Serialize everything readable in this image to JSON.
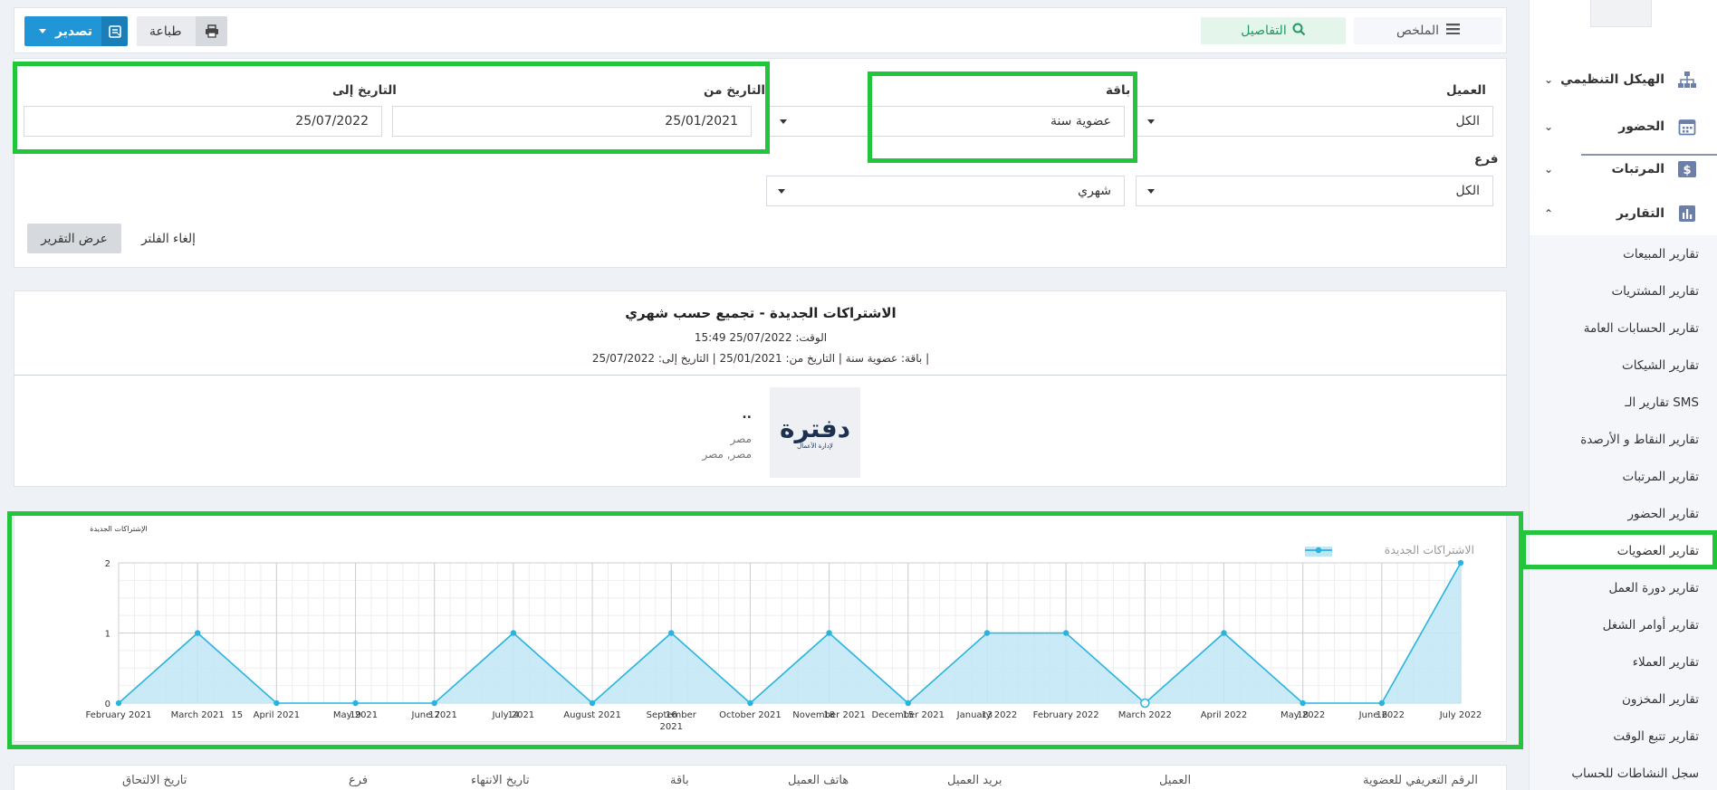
{
  "sidebar": {
    "main_items": [
      {
        "label": "الهيكل التنظيمي",
        "icon": "org-chart-icon",
        "chevron": "⌄"
      },
      {
        "label": "الحضور",
        "icon": "calendar-icon",
        "chevron": "⌄"
      },
      {
        "label": "المرتبات",
        "icon": "dollar-icon",
        "chevron": "⌄"
      },
      {
        "label": "التقارير",
        "icon": "bar-chart-icon",
        "chevron": "⌃"
      }
    ],
    "sub_items": [
      "تقارير المبيعات",
      "تقارير المشتريات",
      "تقارير الحسابات العامة",
      "تقارير الشيكات",
      "تقارير الـ SMS",
      "تقارير النقاط و الأرصدة",
      "تقارير المرتبات",
      "تقارير الحضور",
      "تقارير العضويات",
      "تقارير دورة العمل",
      "تقارير أوامر الشغل",
      "تقارير العملاء",
      "تقارير المخزون",
      "تقارير تتبع الوقت",
      "سجل النشاطات للحساب"
    ],
    "active_sub_index": 8
  },
  "toolbar": {
    "export_label": "تصدير",
    "print_label": "طباعة",
    "details_label": "التفاصيل",
    "summary_label": "الملخص"
  },
  "filters": {
    "client_label": "العميل",
    "client_value": "الكل",
    "package_label": "باقة",
    "package_value": "عضوية سنة",
    "date_from_label": "التاريخ من",
    "date_from_value": "25/01/2021",
    "date_to_label": "التاريخ إلى",
    "date_to_value": "25/07/2022",
    "branch_label": "فرع",
    "branch_value": "الكل",
    "group_value": "شهري",
    "show_report_label": "عرض التقرير",
    "clear_filter_label": "إلغاء الفلتر"
  },
  "report": {
    "title": "الاشتراكات الجديدة - تجميع حسب شهري",
    "time_line": "الوقت: 25/07/2022 15:49",
    "filter_line": "باقة: عضوية سنة | التاريخ من: 25/01/2021 | التاريخ إلى: 25/07/2022 |",
    "company_name": "..",
    "country": "مصر",
    "address": "مصر, مصر",
    "logo_text": "دفترة",
    "logo_subtext": "لإدارة الأعمال"
  },
  "colors": {
    "highlight": "#22c53b",
    "accent_blue": "#2196d7",
    "line": "#29b3e0",
    "area": "#bfe6f4"
  },
  "chart_data": {
    "type": "area",
    "ylabel": "الإشتراكات الجديدة",
    "legend": [
      "الاشتراكات الجديدة"
    ],
    "legend_position": "top-right",
    "grid": true,
    "ylim": [
      0,
      2
    ],
    "yticks": [
      0,
      1,
      2
    ],
    "x": [
      "February 2021",
      "March 2021",
      "April 2021",
      "May 2021",
      "June 2021",
      "July 2021",
      "August 2021",
      "September 2021",
      "October 2021",
      "November 2021",
      "December 2021",
      "January 2022",
      "February 2022",
      "March 2022",
      "April 2022",
      "May 2022",
      "June 2022",
      "July 2022"
    ],
    "series": [
      {
        "name": "الاشتراكات الجديدة",
        "values": [
          0,
          1,
          0,
          0,
          0,
          1,
          0,
          1,
          0,
          1,
          0,
          1,
          1,
          0,
          1,
          0,
          0,
          2
        ]
      }
    ],
    "minor_tick_labels": [
      "15",
      "19",
      "17",
      "14",
      "16",
      "18",
      "15",
      "13",
      "18",
      "16"
    ]
  },
  "table": {
    "headers": [
      "الرقم التعريفي للعضوية",
      "العميل",
      "بريد العميل",
      "هاتف العميل",
      "باقة",
      "تاريخ الانتهاء",
      "فرع",
      "تاريخ الالتحاق"
    ]
  }
}
